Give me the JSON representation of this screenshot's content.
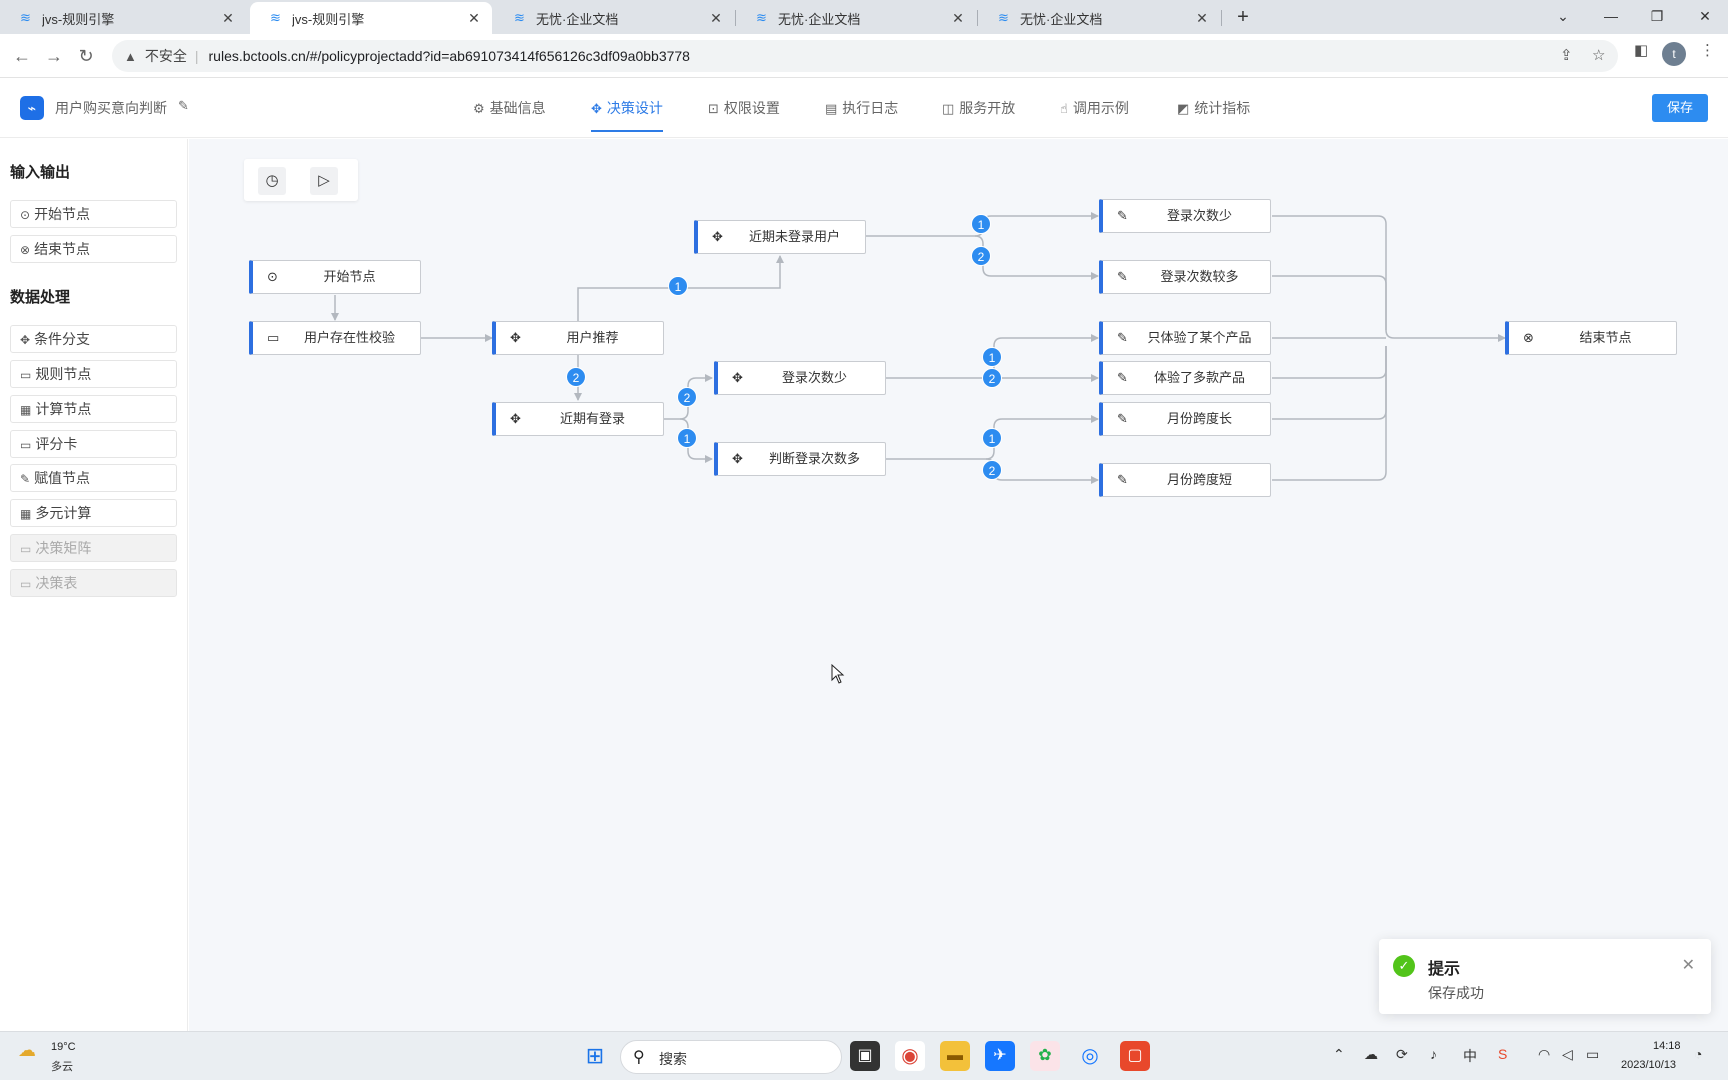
{
  "browser": {
    "tabs": [
      {
        "title": "jvs-规则引擎"
      },
      {
        "title": "jvs-规则引擎"
      },
      {
        "title": "无忧·企业文档"
      },
      {
        "title": "无忧·企业文档"
      },
      {
        "title": "无忧·企业文档"
      }
    ],
    "security_label": "不安全",
    "url": "rules.bctools.cn/#/policyprojectadd?id=ab691073414f656126c3df09a0bb3778",
    "profile_initial": "t"
  },
  "app": {
    "project_name": "用户购买意向判断",
    "nav_tabs": [
      {
        "label": "基础信息",
        "icon": "gear-icon"
      },
      {
        "label": "决策设计",
        "icon": "move-icon"
      },
      {
        "label": "权限设置",
        "icon": "lock-icon"
      },
      {
        "label": "执行日志",
        "icon": "document-icon"
      },
      {
        "label": "服务开放",
        "icon": "book-icon"
      },
      {
        "label": "调用示例",
        "icon": "pointer-icon"
      },
      {
        "label": "统计指标",
        "icon": "chart-icon"
      }
    ],
    "save_label": "保存",
    "accent_color": "#2d8cf0"
  },
  "sidebar": {
    "io_title": "输入输出",
    "io_items": [
      {
        "label": "开始节点",
        "icon": "play-circle-icon"
      },
      {
        "label": "结束节点",
        "icon": "close-circle-icon"
      }
    ],
    "data_title": "数据处理",
    "data_items": [
      {
        "label": "条件分支",
        "icon": "move-icon"
      },
      {
        "label": "规则节点",
        "icon": "list-icon"
      },
      {
        "label": "计算节点",
        "icon": "calculator-icon"
      },
      {
        "label": "评分卡",
        "icon": "card-icon"
      },
      {
        "label": "赋值节点",
        "icon": "edit-icon"
      },
      {
        "label": "多元计算",
        "icon": "table-icon"
      },
      {
        "label": "决策矩阵",
        "icon": "grid-icon",
        "disabled": true
      },
      {
        "label": "决策表",
        "icon": "table-icon",
        "disabled": true
      }
    ]
  },
  "flow": {
    "nodes": [
      {
        "id": "start",
        "label": "开始节点",
        "icon": "play-circle-icon"
      },
      {
        "id": "check",
        "label": "用户存在性校验",
        "icon": "card-icon"
      },
      {
        "id": "recommend",
        "label": "用户推荐",
        "icon": "move-icon"
      },
      {
        "id": "no_login",
        "label": "近期未登录用户",
        "icon": "move-icon"
      },
      {
        "id": "has_login",
        "label": "近期有登录",
        "icon": "move-icon"
      },
      {
        "id": "login_few_a",
        "label": "登录次数少",
        "icon": "move-icon"
      },
      {
        "id": "judge_count",
        "label": "判断登录次数多",
        "icon": "move-icon"
      },
      {
        "id": "r_few",
        "label": "登录次数少",
        "icon": "edit-icon"
      },
      {
        "id": "r_many",
        "label": "登录次数较多",
        "icon": "edit-icon"
      },
      {
        "id": "r_one_product",
        "label": "只体验了某个产品",
        "icon": "edit-icon"
      },
      {
        "id": "r_multi_product",
        "label": "体验了多款产品",
        "icon": "edit-icon"
      },
      {
        "id": "r_long",
        "label": "月份跨度长",
        "icon": "edit-icon"
      },
      {
        "id": "r_short",
        "label": "月份跨度短",
        "icon": "edit-icon"
      },
      {
        "id": "end",
        "label": "结束节点",
        "icon": "close-circle-icon"
      }
    ],
    "badges": [
      "1",
      "2",
      "1",
      "2",
      "2",
      "1",
      "1",
      "2",
      "1",
      "2"
    ]
  },
  "toast": {
    "title": "提示",
    "message": "保存成功"
  },
  "taskbar": {
    "temperature": "19°C",
    "weather": "多云",
    "search_placeholder": "搜索",
    "time": "14:18",
    "date": "2023/10/13",
    "ime": "中"
  }
}
